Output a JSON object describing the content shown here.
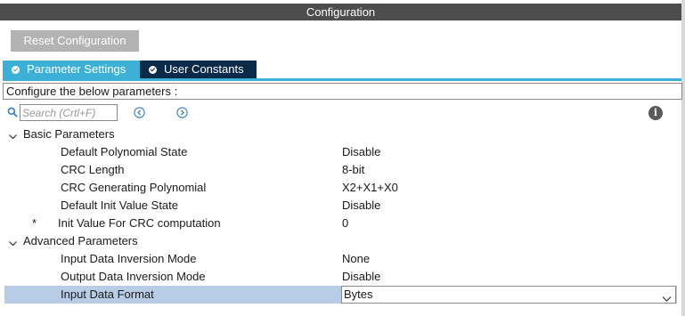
{
  "window": {
    "title": "Configuration"
  },
  "toolbar": {
    "reset_label": "Reset Configuration"
  },
  "tabs": [
    {
      "label": "Parameter Settings",
      "icon": "check-circle-icon",
      "active": true
    },
    {
      "label": "User Constants",
      "icon": "check-circle-icon",
      "active": false
    }
  ],
  "description": "Configure the below parameters :",
  "search": {
    "placeholder": "Search (Crtl+F)"
  },
  "colors": {
    "title_bar": "#4d4d4d",
    "tab_active": "#3db0d8",
    "tab_inactive": "#0a2a4a",
    "selection": "#b7cde6",
    "button": "#b3b3b3"
  },
  "groups": [
    {
      "label": "Basic Parameters",
      "params": [
        {
          "name": "Default Polynomial State",
          "value": "Disable"
        },
        {
          "name": "CRC Length",
          "value": "8-bit"
        },
        {
          "name": "CRC Generating Polynomial",
          "value": "X2+X1+X0"
        },
        {
          "name": "Default Init Value State",
          "value": "Disable"
        },
        {
          "name": "Init Value For CRC computation",
          "value": "0",
          "marker": "*"
        }
      ]
    },
    {
      "label": "Advanced Parameters",
      "params": [
        {
          "name": "Input Data Inversion Mode",
          "value": "None"
        },
        {
          "name": "Output Data Inversion Mode",
          "value": "Disable"
        },
        {
          "name": "Input Data Format",
          "value": "Bytes"
        }
      ]
    }
  ]
}
